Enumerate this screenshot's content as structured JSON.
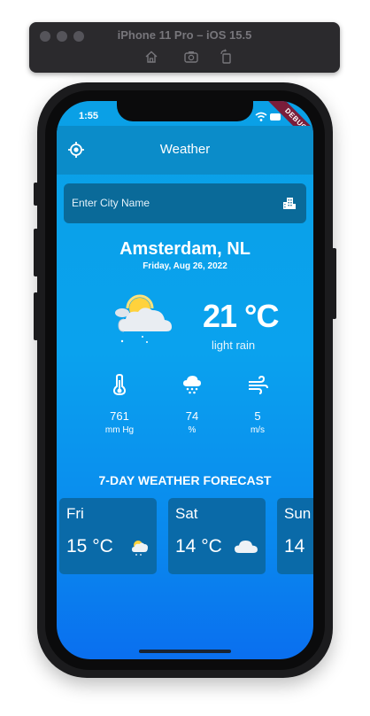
{
  "simulator": {
    "title": "iPhone 11 Pro – iOS 15.5",
    "tools": [
      "home-icon",
      "screenshot-icon",
      "rotate-icon"
    ]
  },
  "status_bar": {
    "time": "1:55",
    "icons": [
      "wifi-icon",
      "battery-icon"
    ]
  },
  "debug_banner": "DEBUG",
  "app_bar": {
    "title": "Weather",
    "leading_icon": "my-location-icon"
  },
  "search": {
    "placeholder": "Enter City Name",
    "value": "",
    "trailing_icon": "city-icon"
  },
  "current": {
    "city": "Amsterdam, NL",
    "date": "Friday, Aug 26, 2022",
    "temperature": "21 °C",
    "description": "light rain",
    "icon": "sun-cloud-rain-icon"
  },
  "stats": [
    {
      "icon": "thermometer-icon",
      "value": "761",
      "unit": "mm Hg"
    },
    {
      "icon": "rain-cloud-icon",
      "value": "74",
      "unit": "%"
    },
    {
      "icon": "wind-icon",
      "value": "5",
      "unit": "m/s"
    }
  ],
  "forecast": {
    "title": "7-DAY WEATHER FORECAST",
    "days": [
      {
        "day": "Fri",
        "temp": "15 °C",
        "icon": "sun-cloud-rain-icon"
      },
      {
        "day": "Sat",
        "temp": "14 °C",
        "icon": "cloud-icon"
      },
      {
        "day": "Sun",
        "temp": "14",
        "icon": ""
      }
    ]
  },
  "colors": {
    "screen_top": "#0aa0e6",
    "screen_bottom": "#0a6fef",
    "app_bar": "#0b8cc9",
    "card": "#0a6aa8",
    "debug_ribbon": "#7a1d3a"
  }
}
